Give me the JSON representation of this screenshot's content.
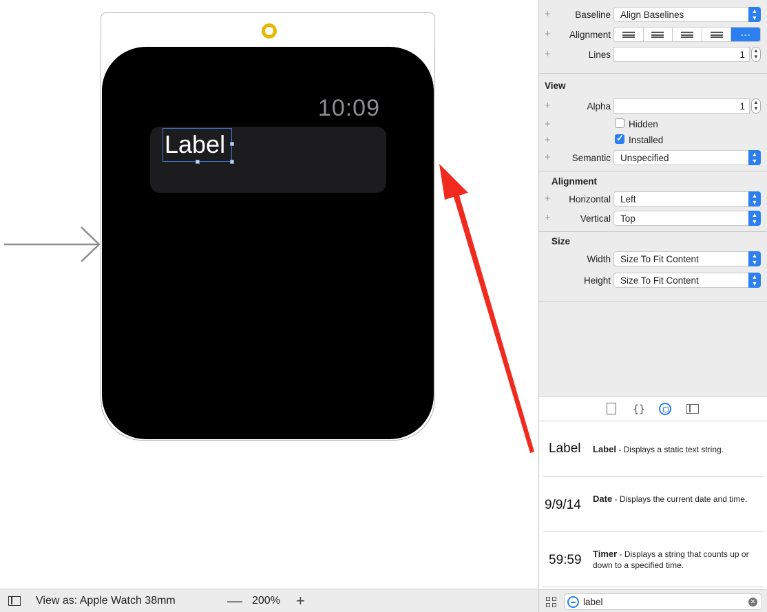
{
  "canvas": {
    "watch_time": "10:09",
    "label_text": "Label"
  },
  "bottombar": {
    "view_as": "View as: Apple Watch 38mm",
    "zoom_minus": "—",
    "zoom_value": "200%",
    "zoom_plus": "+"
  },
  "inspector": {
    "baseline": {
      "key": "Baseline",
      "value": "Align Baselines"
    },
    "alignment": {
      "key": "Alignment",
      "active_segment": "---"
    },
    "lines": {
      "key": "Lines",
      "value": "1"
    },
    "view_section": "View",
    "alpha": {
      "key": "Alpha",
      "value": "1"
    },
    "hidden": {
      "label": "Hidden",
      "checked": false
    },
    "installed": {
      "label": "Installed",
      "checked": true
    },
    "semantic": {
      "key": "Semantic",
      "value": "Unspecified"
    },
    "alignment_section": "Alignment",
    "horizontal": {
      "key": "Horizontal",
      "value": "Left"
    },
    "vertical": {
      "key": "Vertical",
      "value": "Top"
    },
    "size_section": "Size",
    "width": {
      "key": "Width",
      "value": "Size To Fit Content"
    },
    "height": {
      "key": "Height",
      "value": "Size To Fit Content"
    }
  },
  "library": {
    "tabs": [
      "file-icon",
      "braces-icon",
      "object-library-icon",
      "media-icon"
    ],
    "items": [
      {
        "preview": "Label",
        "name": "Label",
        "desc": " - Displays a static text string."
      },
      {
        "preview": "9/9/14",
        "name": "Date",
        "desc": " - Displays the current date and time."
      },
      {
        "preview": "59:59",
        "name": "Timer",
        "desc": " - Displays a string that counts up or down to a specified time."
      }
    ],
    "filter_value": "label"
  },
  "colors": {
    "accent": "#2c7ff0",
    "arrow": "#f02a1e",
    "entry_ring": "#e8b800",
    "selection": "#3d78c8"
  }
}
